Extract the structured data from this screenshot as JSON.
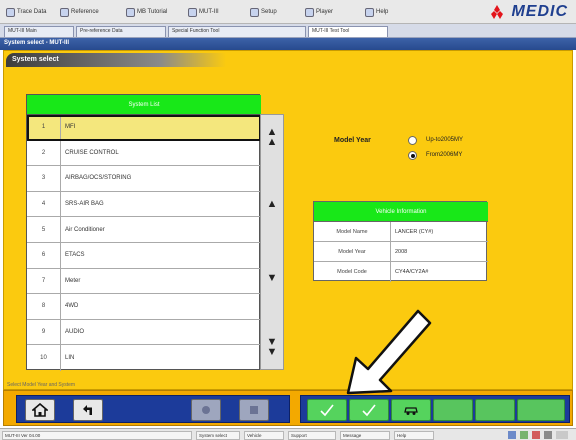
{
  "toolbar": {
    "items": [
      {
        "label": "Trace Data",
        "icon": "trace-icon"
      },
      {
        "label": "Reference",
        "icon": "reference-icon"
      },
      {
        "label": "MB Tutorial",
        "icon": "tutorial-icon"
      },
      {
        "label": "MUT-III",
        "icon": "mut-icon"
      },
      {
        "label": "Setup",
        "icon": "setup-icon"
      },
      {
        "label": "Player",
        "icon": "player-icon"
      },
      {
        "label": "Help",
        "icon": "help-icon"
      }
    ],
    "brand": "MEDIC"
  },
  "tabs": [
    {
      "label": "MUT-III Main"
    },
    {
      "label": "Pre-reference Data"
    },
    {
      "label": "Special Function Tool"
    },
    {
      "label": "MUT-III Test Tool"
    }
  ],
  "window_title": "System select - MUT-III",
  "page_header": "System select",
  "systems": {
    "header": "System List",
    "rows": [
      {
        "num": "1",
        "label": "MFI"
      },
      {
        "num": "2",
        "label": "CRUISE CONTROL"
      },
      {
        "num": "3",
        "label": "AIRBAG/OCS/STORING"
      },
      {
        "num": "4",
        "label": "SRS-AIR BAG"
      },
      {
        "num": "5",
        "label": "Air Conditioner"
      },
      {
        "num": "6",
        "label": "ETACS"
      },
      {
        "num": "7",
        "label": "Meter"
      },
      {
        "num": "8",
        "label": "4WD"
      },
      {
        "num": "9",
        "label": "AUDIO"
      },
      {
        "num": "10",
        "label": "LIN"
      }
    ],
    "selected_index": 0
  },
  "model_year": {
    "label": "Model Year",
    "options": [
      {
        "label": "Up-to2005MY",
        "checked": false
      },
      {
        "label": "From2006MY",
        "checked": true
      }
    ]
  },
  "vehicle_info": {
    "header": "Vehicle Information",
    "rows": [
      {
        "key": "Model Name",
        "value": "LANCER (CY#)"
      },
      {
        "key": "Model Year",
        "value": "2008"
      },
      {
        "key": "Model Code",
        "value": "CY4A/CY2A#"
      }
    ]
  },
  "status_text": "Select Model Year and System",
  "taskbar": {
    "items": [
      "MUT-III Ver 04.00",
      "System select",
      "Vehicle",
      "Support",
      "Message",
      "Help"
    ]
  },
  "colors": {
    "panel_bg": "#fbca0f",
    "header_green": "#18e818",
    "button_bar": "#f3a900",
    "button_group": "#1c3b9a"
  }
}
